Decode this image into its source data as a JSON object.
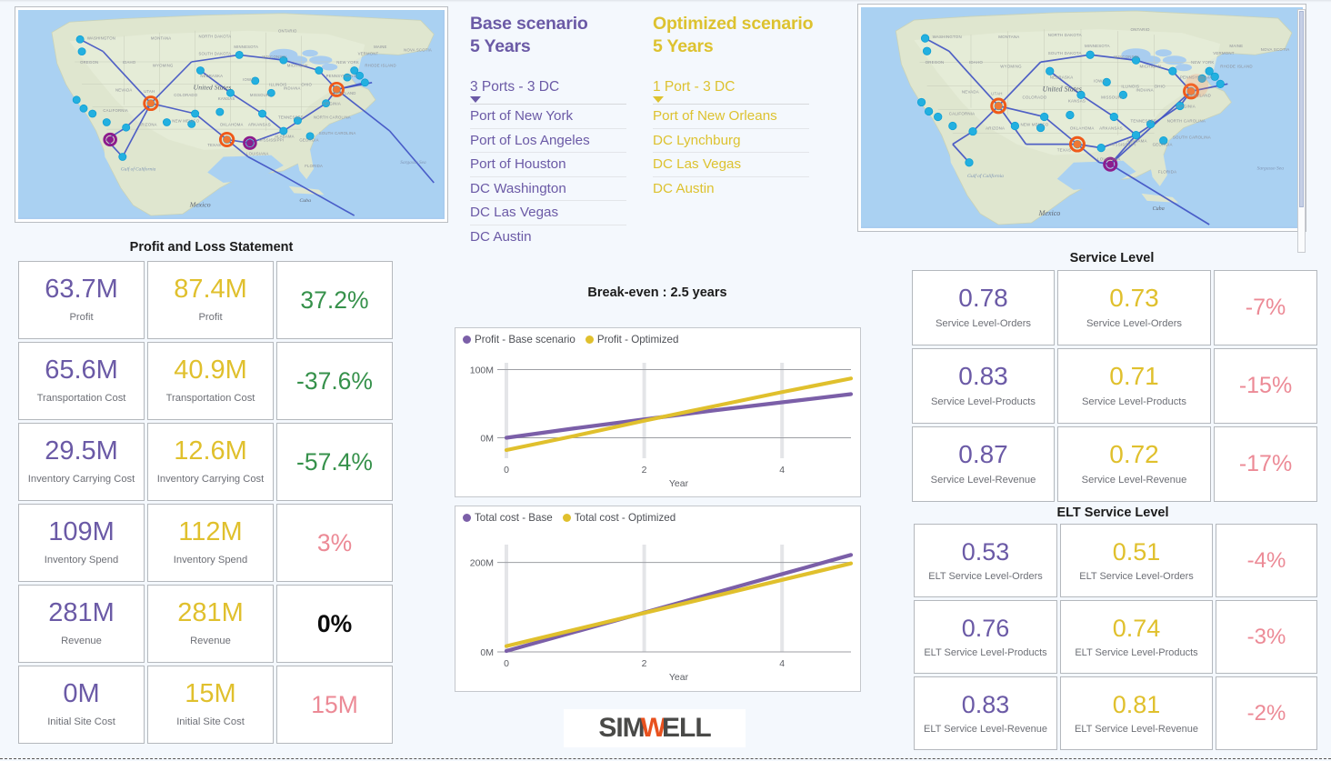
{
  "scenarios": {
    "base": {
      "title_line1": "Base scenario",
      "title_line2": "5 Years",
      "dropdown_value": "3 Ports - 3 DC",
      "items": [
        "Port of New York",
        "Port of Los Angeles",
        "Port of Houston",
        "DC Washington",
        "DC Las Vegas",
        "DC Austin"
      ],
      "color": "#6b5aa6"
    },
    "optimized": {
      "title_line1": "Optimized scenario",
      "title_line2": "5 Years",
      "dropdown_value": "1 Port - 3 DC",
      "items": [
        "Port of New Orleans",
        "DC Lynchburg",
        "DC Las Vegas",
        "DC Austin"
      ],
      "color": "#e0c02d"
    }
  },
  "maps": {
    "left": {
      "country_label": "United States",
      "water_label_1": "Gulf of California",
      "water_label_2": "Sargasso Sea",
      "mexico_label": "Mexico",
      "cuba_label": "Cuba"
    },
    "right": {
      "country_label": "United States",
      "water_label_1": "Gulf of California",
      "water_label_2": "Sargasso Sea",
      "mexico_label": "Mexico",
      "cuba_label": "Cuba"
    }
  },
  "pnl": {
    "title": "Profit and Loss Statement",
    "rows": [
      {
        "label": "Profit",
        "base": "63.7M",
        "optimized": "87.4M",
        "delta": "37.2%",
        "delta_color": "green"
      },
      {
        "label": "Transportation Cost",
        "base": "65.6M",
        "optimized": "40.9M",
        "delta": "-37.6%",
        "delta_color": "green"
      },
      {
        "label": "Inventory Carrying Cost",
        "base": "29.5M",
        "optimized": "12.6M",
        "delta": "-57.4%",
        "delta_color": "green"
      },
      {
        "label": "Inventory Spend",
        "base": "109M",
        "optimized": "112M",
        "delta": "3%",
        "delta_color": "pink"
      },
      {
        "label": "Revenue",
        "base": "281M",
        "optimized": "281M",
        "delta": "0%",
        "delta_color": "black"
      },
      {
        "label": "Initial Site Cost",
        "base": "0M",
        "optimized": "15M",
        "delta": "15M",
        "delta_color": "pink"
      }
    ]
  },
  "service_level": {
    "title": "Service Level",
    "rows": [
      {
        "label": "Service Level-Orders",
        "base": "0.78",
        "optimized": "0.73",
        "delta": "-7%",
        "delta_color": "pink"
      },
      {
        "label": "Service Level-Products",
        "base": "0.83",
        "optimized": "0.71",
        "delta": "-15%",
        "delta_color": "pink"
      },
      {
        "label": "Service Level-Revenue",
        "base": "0.87",
        "optimized": "0.72",
        "delta": "-17%",
        "delta_color": "pink"
      }
    ]
  },
  "elt_service_level": {
    "title": "ELT Service Level",
    "rows": [
      {
        "label": "ELT Service Level-Orders",
        "base": "0.53",
        "optimized": "0.51",
        "delta": "-4%",
        "delta_color": "pink"
      },
      {
        "label": "ELT Service Level-Products",
        "base": "0.76",
        "optimized": "0.74",
        "delta": "-3%",
        "delta_color": "pink"
      },
      {
        "label": "ELT Service Level-Revenue",
        "base": "0.83",
        "optimized": "0.81",
        "delta": "-2%",
        "delta_color": "pink"
      }
    ]
  },
  "break_even_title": "Break-even : 2.5 years",
  "logo": {
    "text_left": "SIM",
    "text_mid": "W",
    "text_right": "ELL",
    "accent": "#e8521f"
  },
  "chart_data": [
    {
      "type": "line",
      "title": "Break-even : 2.5 years",
      "xlabel": "Year",
      "ylabel": "",
      "x": [
        0,
        1,
        2,
        3,
        4,
        5
      ],
      "xlim": [
        0,
        5
      ],
      "ylim": [
        -30,
        110
      ],
      "yticks": [
        "0M",
        "100M"
      ],
      "ytick_values": [
        0,
        100
      ],
      "xticks": [
        "0",
        "2",
        "4"
      ],
      "xtick_values": [
        0,
        2,
        4
      ],
      "grid": true,
      "legend_position": "top-left",
      "series": [
        {
          "name": "Profit - Base scenario",
          "color": "#7b5fa8",
          "values": [
            0,
            14,
            27,
            40,
            52,
            64
          ]
        },
        {
          "name": "Profit - Optimized",
          "color": "#e0c02d",
          "values": [
            -18,
            3,
            25,
            46,
            67,
            87
          ]
        }
      ]
    },
    {
      "type": "line",
      "title": "",
      "xlabel": "Year",
      "ylabel": "",
      "x": [
        0,
        1,
        2,
        3,
        4,
        5
      ],
      "xlim": [
        0,
        5
      ],
      "ylim": [
        0,
        240
      ],
      "yticks": [
        "0M",
        "200M"
      ],
      "ytick_values": [
        0,
        200
      ],
      "xticks": [
        "0",
        "2",
        "4"
      ],
      "xtick_values": [
        0,
        2,
        4
      ],
      "grid": true,
      "legend_position": "top-left",
      "series": [
        {
          "name": "Total cost - Base",
          "color": "#7b5fa8",
          "values": [
            2,
            45,
            88,
            131,
            174,
            217
          ]
        },
        {
          "name": "Total cost - Optimized",
          "color": "#e0c02d",
          "values": [
            13,
            50,
            87,
            124,
            161,
            198
          ]
        }
      ]
    }
  ]
}
